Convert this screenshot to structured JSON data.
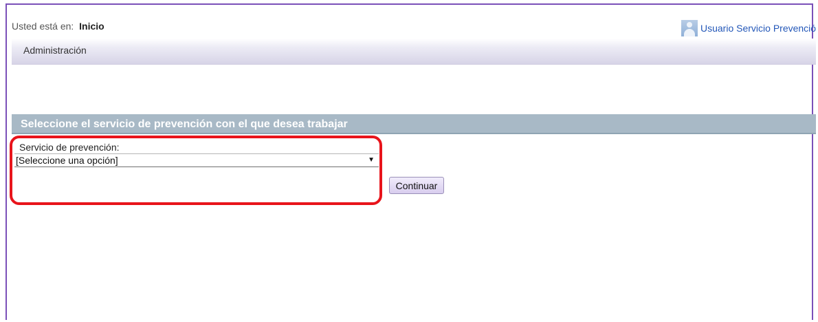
{
  "breadcrumb": {
    "prefix": "Usted está en:",
    "current": "Inicio"
  },
  "user": {
    "name": "Usuario Servicio Prevención"
  },
  "menu": {
    "items": [
      {
        "label": "Administración"
      }
    ]
  },
  "section": {
    "title": "Seleccione el servicio de prevención con el que desea trabajar"
  },
  "form": {
    "service_label": "Servicio de prevención:",
    "service_select": {
      "selected": "[Seleccione una opción]"
    },
    "continue_label": "Continuar"
  },
  "colors": {
    "frame_border": "#7a4fb8",
    "section_header_bg": "#a8b9c6",
    "highlight": "#e8141b",
    "link": "#2357b8"
  },
  "icons": {
    "avatar": "user-avatar-icon",
    "select_arrow": "triangle-down-icon"
  }
}
